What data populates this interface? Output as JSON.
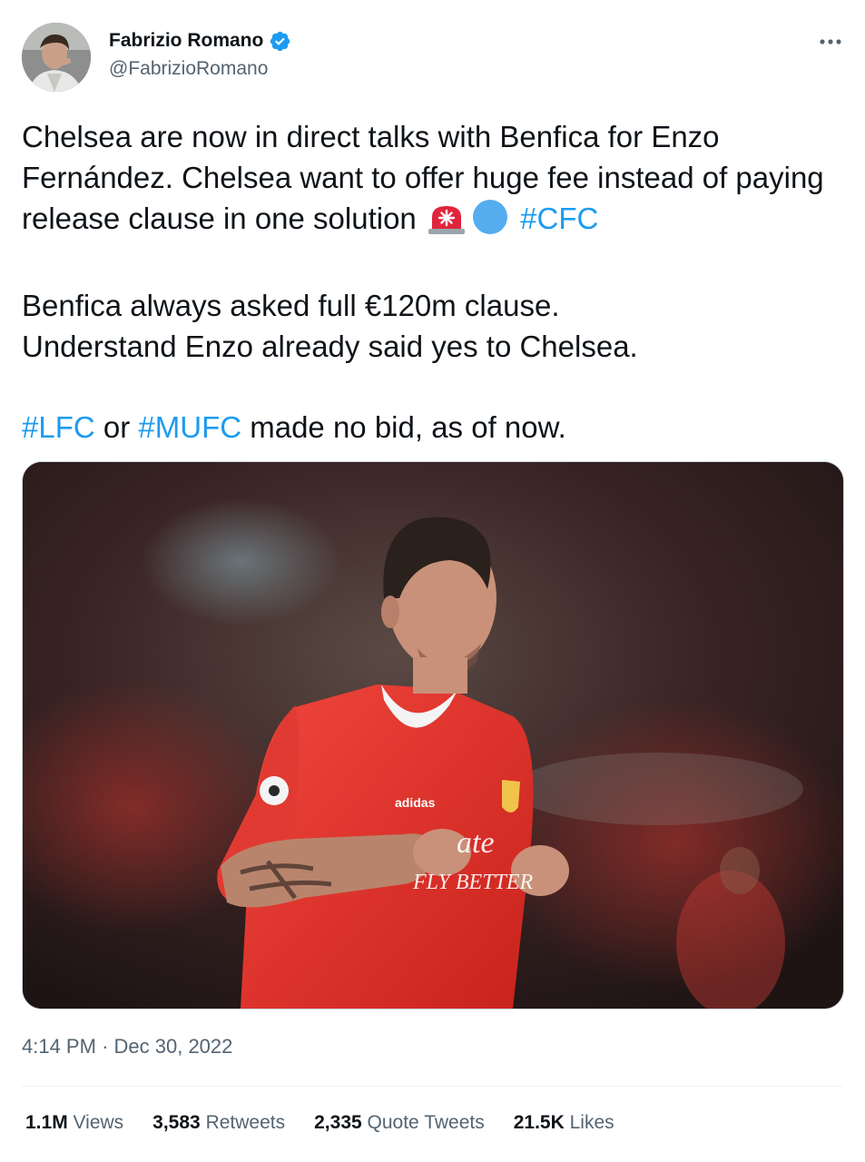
{
  "author": {
    "display_name": "Fabrizio Romano",
    "handle": "@FabrizioRomano",
    "verified_icon": "verified-badge-icon",
    "avatar_icon": "profile-avatar"
  },
  "more_icon": "more-options-icon",
  "tweet": {
    "line1": "Chelsea are now in direct talks with Benfica for Enzo Fernández. Chelsea want to offer huge fee instead of paying release clause in one solution",
    "emoji_siren": "🚨",
    "emoji_circle": "🔵",
    "hashtag_cfc": "#CFC",
    "line2a": "Benfica always asked full €120m clause.",
    "line2b": "Understand Enzo already said yes to Chelsea.",
    "hashtag_lfc": "#LFC",
    "word_or": "or",
    "hashtag_mufc": "#MUFC",
    "line3_tail": "made no bid, as of now."
  },
  "media": {
    "kind": "photo",
    "jersey_sponsor_text": "Emirates FLY BETTER",
    "kit_brand": "adidas"
  },
  "meta": {
    "time": "4:14 PM",
    "separator": "·",
    "date": "Dec 30, 2022"
  },
  "stats": {
    "views_count": "1.1M",
    "views_label": "Views",
    "retweets_count": "3,583",
    "retweets_label": "Retweets",
    "quotes_count": "2,335",
    "quotes_label": "Quote Tweets",
    "likes_count": "21.5K",
    "likes_label": "Likes"
  },
  "colors": {
    "link": "#1d9bf0",
    "secondary_text": "#536471",
    "primary_text": "#0f1419",
    "jersey_red": "#e8322b"
  }
}
